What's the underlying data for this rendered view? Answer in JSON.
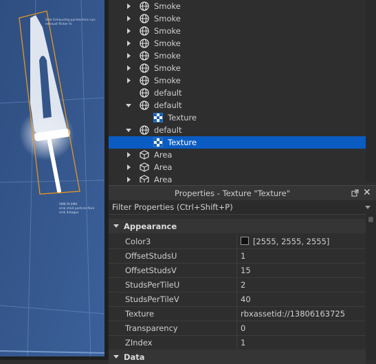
{
  "colors": {
    "panel_bg": "#2e2e2e",
    "selection": "#0b5cc2",
    "viewport_sky": "#34558a",
    "outline": "#e8961e"
  },
  "explorer": {
    "items": [
      {
        "label": "Smoke",
        "icon": "particle-emitter-icon",
        "expander": "collapsed"
      },
      {
        "label": "Smoke",
        "icon": "particle-emitter-icon",
        "expander": "collapsed"
      },
      {
        "label": "Smoke",
        "icon": "particle-emitter-icon",
        "expander": "collapsed"
      },
      {
        "label": "Smoke",
        "icon": "particle-emitter-icon",
        "expander": "collapsed"
      },
      {
        "label": "Smoke",
        "icon": "particle-emitter-icon",
        "expander": "collapsed"
      },
      {
        "label": "Smoke",
        "icon": "particle-emitter-icon",
        "expander": "collapsed"
      },
      {
        "label": "Smoke",
        "icon": "particle-emitter-icon",
        "expander": "collapsed"
      },
      {
        "label": "default",
        "icon": "particle-emitter-icon",
        "expander": "none"
      },
      {
        "label": "default",
        "icon": "particle-emitter-icon",
        "expander": "expanded"
      },
      {
        "label": "Texture",
        "icon": "texture-icon",
        "expander": "none",
        "child": true
      },
      {
        "label": "default",
        "icon": "particle-emitter-icon",
        "expander": "expanded"
      },
      {
        "label": "Texture",
        "icon": "texture-icon",
        "expander": "none",
        "child": true,
        "selected": true
      },
      {
        "label": "Area",
        "icon": "part-icon",
        "expander": "collapsed"
      },
      {
        "label": "Area",
        "icon": "part-icon",
        "expander": "collapsed"
      },
      {
        "label": "Area",
        "icon": "part-icon",
        "expander": "collapsed"
      }
    ]
  },
  "properties": {
    "title": "Properties - Texture \"Texture\"",
    "filter_placeholder": "Filter Properties (Ctrl+Shift+P)",
    "sections": [
      {
        "name": "Appearance",
        "rows": [
          {
            "name": "Color3",
            "value": "[2555, 2555, 2555]",
            "swatch": "#111111"
          },
          {
            "name": "OffsetStudsU",
            "value": "1"
          },
          {
            "name": "OffsetStudsV",
            "value": "15"
          },
          {
            "name": "StudsPerTileU",
            "value": "2"
          },
          {
            "name": "StudsPerTileV",
            "value": "40"
          },
          {
            "name": "Texture",
            "value": "rbxassetid://13806163725"
          },
          {
            "name": "Transparency",
            "value": "0"
          },
          {
            "name": "ZIndex",
            "value": "1"
          }
        ]
      },
      {
        "name": "Data",
        "rows": []
      }
    ]
  },
  "viewport": {
    "annotation_top": "Smk Exhaustlrg pyrotechnic-cyn\nexhaust flicker fx",
    "annotation_bottom": "SMK M-SMK\nsmk shk4 particle flare\nsmk 4stages"
  }
}
